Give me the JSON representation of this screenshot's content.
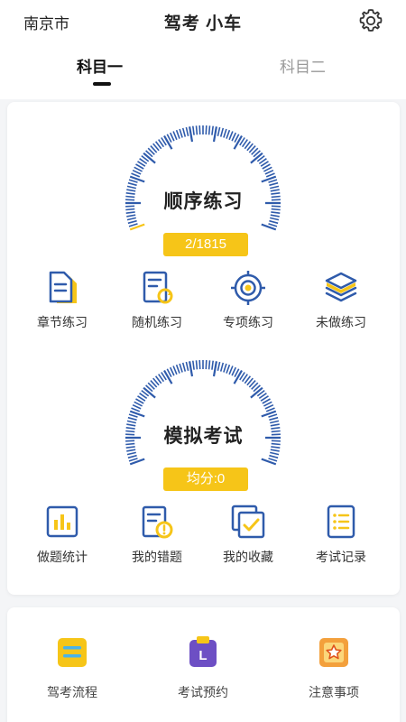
{
  "header": {
    "city": "南京市",
    "title": "驾考 小车",
    "tabs": [
      {
        "label": "科目一",
        "active": true
      },
      {
        "label": "科目二",
        "active": false
      }
    ]
  },
  "practice": {
    "title": "顺序练习",
    "progress_text": "2/1815",
    "progress": {
      "done": 2,
      "total": 1815
    },
    "items": [
      {
        "label": "章节练习",
        "icon": "chapter-practice-icon"
      },
      {
        "label": "随机练习",
        "icon": "random-practice-icon"
      },
      {
        "label": "专项练习",
        "icon": "special-practice-icon"
      },
      {
        "label": "未做练习",
        "icon": "undone-practice-icon"
      }
    ]
  },
  "exam": {
    "title": "模拟考试",
    "score_text": "均分:0",
    "items": [
      {
        "label": "做题统计",
        "icon": "statistics-icon"
      },
      {
        "label": "我的错题",
        "icon": "wrong-questions-icon"
      },
      {
        "label": "我的收藏",
        "icon": "favorites-icon"
      },
      {
        "label": "考试记录",
        "icon": "exam-records-icon"
      }
    ]
  },
  "bottom": {
    "items": [
      {
        "label": "驾考流程",
        "icon": "process-icon"
      },
      {
        "label": "考试预约",
        "icon": "appointment-icon"
      },
      {
        "label": "注意事项",
        "icon": "notice-icon"
      }
    ]
  },
  "colors": {
    "accent_blue": "#2f5bab",
    "yellow": "#f6c518",
    "tab_active": "#111111",
    "tab_inactive": "#999999"
  }
}
